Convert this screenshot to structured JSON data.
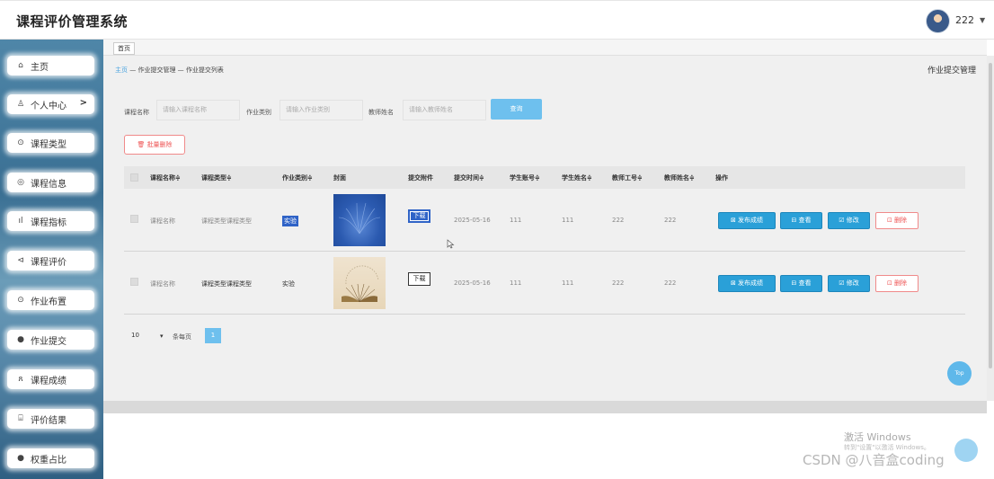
{
  "header": {
    "title": "课程评价管理系统",
    "username": "222"
  },
  "sidebar": {
    "items": [
      {
        "label": "主页",
        "icon": "home-icon",
        "glyph": "⌂"
      },
      {
        "label": "个人中心",
        "icon": "person-icon",
        "glyph": "♙",
        "arrow": ">"
      },
      {
        "label": "课程类型",
        "icon": "circle-icon",
        "glyph": "⊙"
      },
      {
        "label": "课程信息",
        "icon": "circle-info-icon",
        "glyph": "◎"
      },
      {
        "label": "课程指标",
        "icon": "bar-chart-icon",
        "glyph": "ıl"
      },
      {
        "label": "课程评价",
        "icon": "comment-icon",
        "glyph": "⊲"
      },
      {
        "label": "作业布置",
        "icon": "target-icon",
        "glyph": "⊙"
      },
      {
        "label": "作业提交",
        "icon": "user-filled-icon",
        "glyph": "●"
      },
      {
        "label": "课程成绩",
        "icon": "group-icon",
        "glyph": "ጸ"
      },
      {
        "label": "评价结果",
        "icon": "chat-icon",
        "glyph": "⌸"
      },
      {
        "label": "权重占比",
        "icon": "dot-icon",
        "glyph": "●"
      }
    ]
  },
  "tabs": {
    "home": "首页"
  },
  "breadcrumb": {
    "home": "主页",
    "rest": " — 作业提交管理 — 作业提交列表"
  },
  "page_title": "作业提交管理",
  "filters": {
    "course_name_label": "课程名称",
    "course_name_placeholder": "请输入课程名称",
    "hw_type_label": "作业类别",
    "hw_type_placeholder": "请输入作业类别",
    "teacher_label": "教师姓名",
    "teacher_placeholder": "请输入教师姓名",
    "search": "查询"
  },
  "batch_delete": "批量删除",
  "table": {
    "headers": [
      "课程名称≑",
      "课程类型≑",
      "作业类别≑",
      "封面",
      "提交附件",
      "提交时间≑",
      "学生账号≑",
      "学生姓名≑",
      "教师工号≑",
      "教师姓名≑",
      "操作"
    ],
    "rows": [
      {
        "course_name": "课程名称",
        "course_type": "课程类型课程类型",
        "hw_type": "实验",
        "download": "下载",
        "time": "2025-05-16",
        "student_no": "111",
        "student_name": "111",
        "teacher_no": "222",
        "teacher_name": "222"
      },
      {
        "course_name": "课程名称",
        "course_type": "课程类型课程类型",
        "hw_type": "实验",
        "download": "下载",
        "time": "2025-05-16",
        "student_no": "111",
        "student_name": "111",
        "teacher_no": "222",
        "teacher_name": "222"
      }
    ],
    "ops": {
      "publish": "⊠ 发布成绩",
      "view": "⊟ 查看",
      "edit": "☑ 修改",
      "delete": "⊡ 删除"
    }
  },
  "pagination": {
    "page_size": "10",
    "per_page": "条每页",
    "current": "1"
  },
  "top_button": "Top",
  "watermark": {
    "win1": "激活 Windows",
    "win2": "转到\"设置\"以激活 Windows。",
    "csdn": "CSDN @八音盒coding"
  },
  "colors": {
    "accent": "#6ec0ee",
    "primary_button": "#2aa0d8",
    "danger": "#e55555"
  }
}
